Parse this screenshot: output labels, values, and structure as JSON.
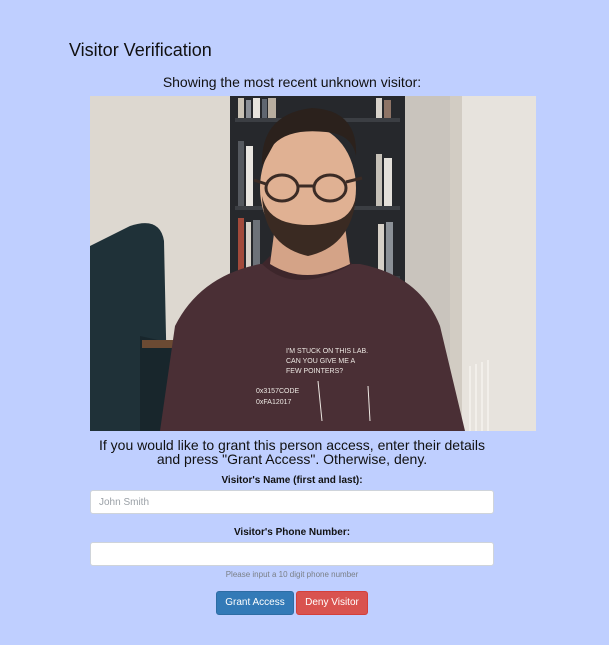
{
  "page": {
    "title": "Visitor Verification",
    "subtitle": "Showing the most recent unknown visitor:",
    "instructions": "If you would like to grant this person access, enter their details and press \"Grant Access\". Otherwise, deny."
  },
  "visitor_image": {
    "shirt_text": [
      "I'M STUCK ON THIS LAB.",
      "CAN YOU GIVE ME A",
      "FEW POINTERS?",
      "0x3157CODE",
      "0xFA12017"
    ]
  },
  "form": {
    "name_label": "Visitor's Name (first and last):",
    "name_placeholder": "John Smith",
    "name_value": "",
    "phone_label": "Visitor's Phone Number:",
    "phone_placeholder": "",
    "phone_value": "",
    "phone_help": "Please input a 10 digit phone number"
  },
  "buttons": {
    "grant_label": "Grant Access",
    "deny_label": "Deny Visitor"
  },
  "colors": {
    "background": "#bfcfff",
    "grant": "#337ab7",
    "deny": "#d9534f"
  }
}
